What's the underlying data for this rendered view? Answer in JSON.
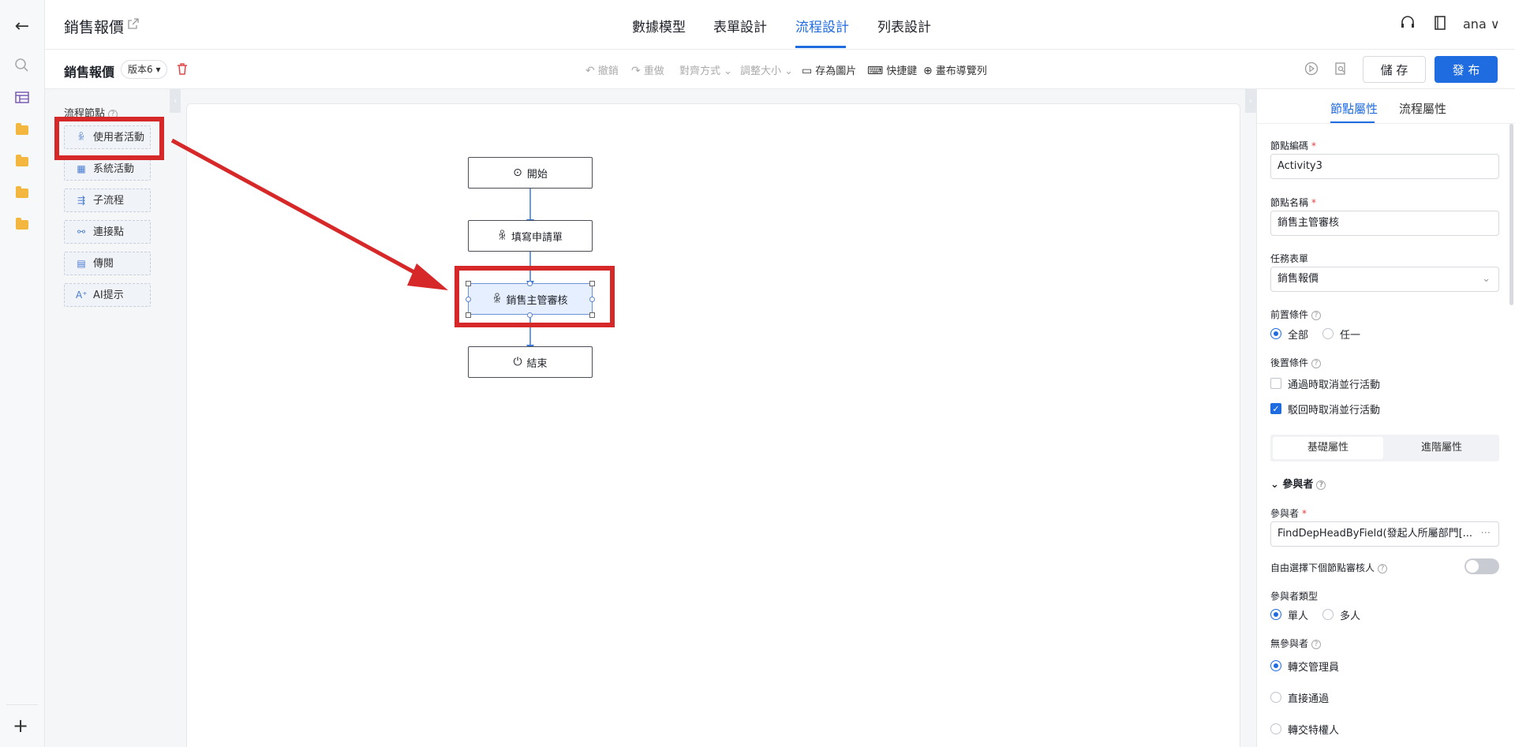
{
  "rail": {
    "back_icon": "arrow-left-icon",
    "add_icon": "plus-icon",
    "icons": [
      "search-icon",
      "table-icon",
      "folder-icon",
      "folder-icon",
      "folder-icon",
      "folder-icon"
    ]
  },
  "header": {
    "app_title": "銷售報價",
    "tabs": [
      "數據模型",
      "表單設計",
      "流程設計",
      "列表設計"
    ],
    "active_tab": "流程設計",
    "user": "ana",
    "user_chevron": "∨"
  },
  "toolbar": {
    "process_name": "銷售報價",
    "version": "版本6 ▾",
    "tools": [
      {
        "icon": "↶",
        "label": "撤銷"
      },
      {
        "icon": "↷",
        "label": "重做"
      },
      {
        "icon": "",
        "label": "對齊方式 ⌄"
      },
      {
        "icon": "",
        "label": "調整大小 ⌄"
      },
      {
        "icon": "▭",
        "label": "存為圖片"
      },
      {
        "icon": "⌨",
        "label": "快捷鍵"
      },
      {
        "icon": "⊕",
        "label": "畫布導覽列"
      }
    ],
    "save_label": "儲 存",
    "publish_label": "發 布"
  },
  "palette": {
    "title": "流程節點",
    "items": [
      {
        "icon": "person-icon",
        "glyph": "ꆜ",
        "label": "使用者活動"
      },
      {
        "icon": "grid-icon",
        "glyph": "▦",
        "label": "系統活動"
      },
      {
        "icon": "subprocess-icon",
        "glyph": "⇶",
        "label": "子流程"
      },
      {
        "icon": "link-icon",
        "glyph": "⚯",
        "label": "連接點"
      },
      {
        "icon": "document-icon",
        "glyph": "▤",
        "label": "傳閱"
      },
      {
        "icon": "ai-icon",
        "glyph": "A⁺",
        "label": "AI提示"
      }
    ]
  },
  "flow": {
    "nodes": [
      {
        "icon": "play-icon",
        "glyph": "⊙",
        "label": "開始"
      },
      {
        "icon": "person-icon",
        "glyph": "ꆜ",
        "label": "填寫申請單"
      },
      {
        "icon": "person-icon",
        "glyph": "ꆜ",
        "label": "銷售主管審核"
      },
      {
        "icon": "power-icon",
        "glyph": "⏻",
        "label": "結束"
      }
    ]
  },
  "panel": {
    "tabs": [
      "節點屬性",
      "流程屬性"
    ],
    "node_code_label": "節點編碼",
    "node_code_value": "Activity3",
    "node_name_label": "節點名稱",
    "node_name_value": "銷售主管審核",
    "task_form_label": "任務表單",
    "task_form_value": "銷售報價",
    "precondition_label": "前置條件",
    "precondition_options": [
      "全部",
      "任一"
    ],
    "postcondition_label": "後置條件",
    "post_check_1": "通過時取消並行活動",
    "post_check_2": "駁回時取消並行活動",
    "seg_tabs": [
      "基礎屬性",
      "進階屬性"
    ],
    "participants_section": "參與者",
    "participant_label": "參與者",
    "participant_value": "FindDepHeadByField(發起人所屬部門[...",
    "participant_more": "···",
    "free_select_label": "自由選擇下個節點審核人",
    "participant_type_label": "參與者類型",
    "participant_type_options": [
      "單人",
      "多人"
    ],
    "no_participant_label": "無參與者",
    "no_participant_options": [
      "轉交管理員",
      "直接通過",
      "轉交特權人"
    ]
  },
  "colors": {
    "accent": "#1f6be0",
    "highlight": "#d62828"
  }
}
